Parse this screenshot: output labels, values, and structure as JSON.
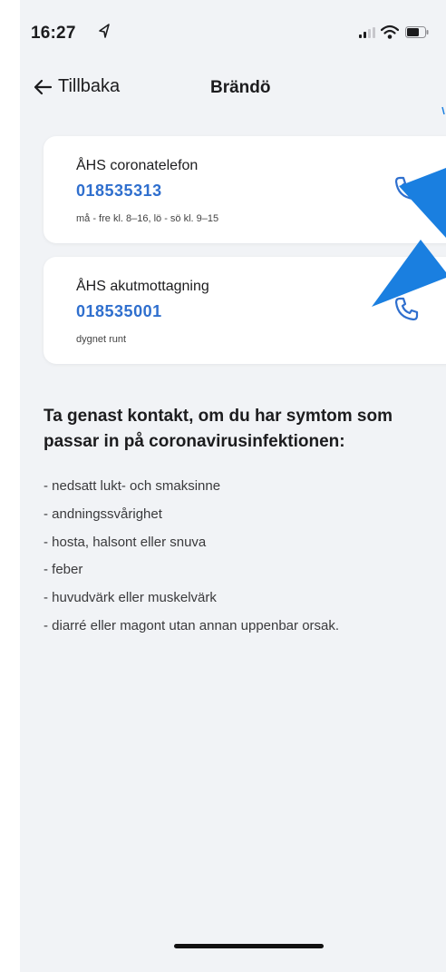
{
  "status_bar": {
    "time": "16:27",
    "icons": [
      "location-arrow-icon",
      "signal-icon",
      "wifi-icon",
      "battery-icon"
    ]
  },
  "nav": {
    "back_label": "Tillbaka",
    "title": "Brändö"
  },
  "contacts": [
    {
      "name": "ÅHS coronatelefon",
      "number": "018535313",
      "hours": "må - fre kl. 8–16, lö - sö kl. 9–15"
    },
    {
      "name": "ÅHS akutmottagning",
      "number": "018535001",
      "hours": "dygnet runt"
    }
  ],
  "symptoms": {
    "heading": "Ta genast kontakt, om du har symtom som passar in på coronavirusinfektionen:",
    "items": [
      "- nedsatt lukt- och smaksinne",
      "- andningssvårighet",
      "- hosta, halsont eller snuva",
      "- feber",
      "- huvudvärk eller muskelvärk",
      "- diarré eller magont utan annan uppenbar orsak."
    ]
  },
  "colors": {
    "accent": "#2f6fce",
    "background": "#f1f3f6",
    "card": "#ffffff",
    "annotation_arrow": "#1a7fe0"
  }
}
